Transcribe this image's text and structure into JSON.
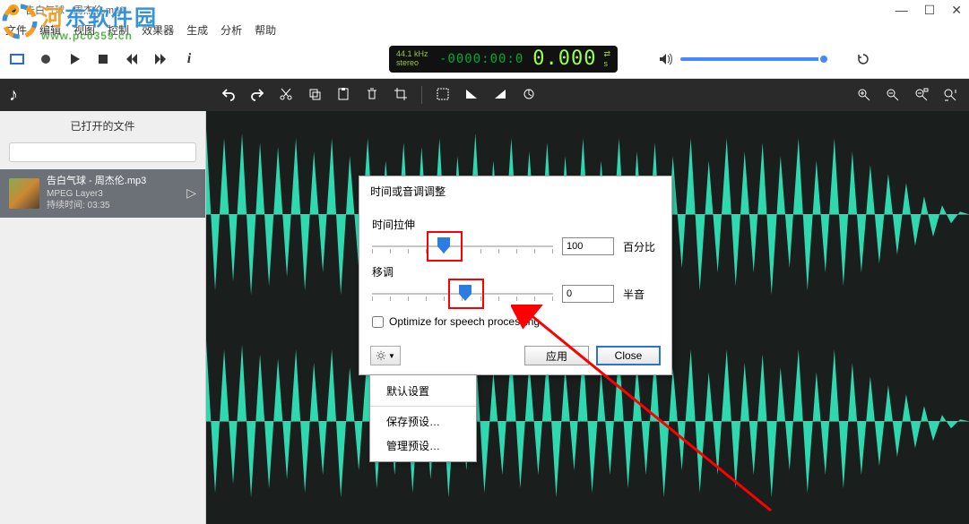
{
  "window": {
    "title": "告白气球 - 周杰伦.mp3"
  },
  "menu": {
    "file": "文件",
    "edit": "编辑",
    "view": "视图",
    "control": "控制",
    "effects": "效果器",
    "generate": "生成",
    "analyze": "分析",
    "help": "帮助"
  },
  "transport": {
    "sample_rate": "44.1 kHz",
    "channels": "stereo",
    "time_small": "-0000:00:0",
    "time_big": "0.000"
  },
  "sidebar": {
    "header": "已打开的文件",
    "search_placeholder": "",
    "tracks": [
      {
        "title": "告白气球 - 周杰伦.mp3",
        "codec": "MPEG Layer3",
        "duration": "持续时间: 03:35"
      }
    ]
  },
  "dialog": {
    "title": "时间或音调调整",
    "time_stretch_label": "时间拉伸",
    "time_stretch_value": "100",
    "time_stretch_unit": "百分比",
    "pitch_label": "移调",
    "pitch_value": "0",
    "pitch_unit": "半音",
    "optimize_label": "Optimize for speech processing",
    "apply": "应用",
    "close": "Close"
  },
  "dropdown": {
    "default": "默认设置",
    "save_preset": "保存预设…",
    "manage_preset": "管理预设…"
  },
  "watermark": {
    "text": "河东软件园",
    "url": "www.pc0359.cn"
  }
}
